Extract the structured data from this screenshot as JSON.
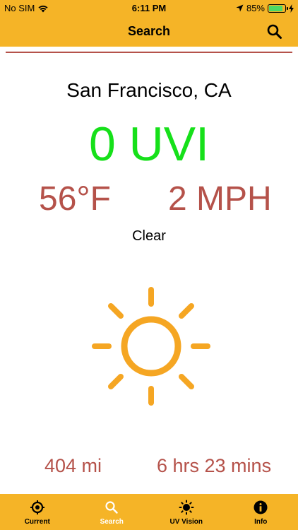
{
  "status_bar": {
    "carrier": "No SIM",
    "time": "6:11 PM",
    "battery": "85%",
    "battery_level": 0.85
  },
  "nav": {
    "title": "Search",
    "search_icon": "search-icon"
  },
  "weather": {
    "city": "San Francisco, CA",
    "uvi": "0 UVI",
    "temperature": "56°F",
    "wind": "2 MPH",
    "condition": "Clear",
    "condition_icon": "sun-icon"
  },
  "footer_stats": {
    "distance": "404 mi",
    "time_left": "6 hrs 23 mins"
  },
  "tabs": [
    {
      "label": "Current",
      "icon": "location-target-icon",
      "active": false
    },
    {
      "label": "Search",
      "icon": "search-icon",
      "active": true
    },
    {
      "label": "UV Vision",
      "icon": "sun-icon",
      "active": false
    },
    {
      "label": "Info",
      "icon": "info-icon",
      "active": false
    }
  ],
  "colors": {
    "bar": "#F5B427",
    "accent_red": "#B5524A",
    "uvi_green": "#16E01A",
    "sun_orange": "#F5A623"
  }
}
